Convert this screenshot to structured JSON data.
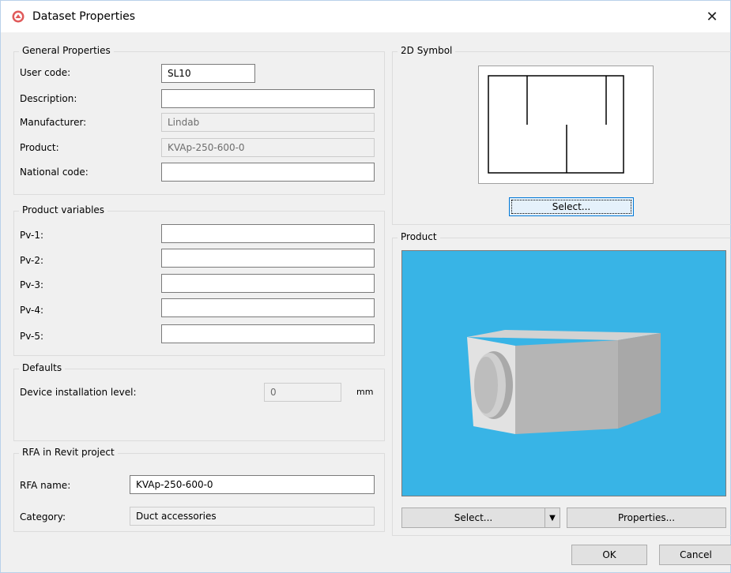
{
  "window": {
    "title": "Dataset Properties",
    "close_glyph": "✕"
  },
  "general": {
    "heading": "General Properties",
    "user_code_label": "User code:",
    "user_code_value": "SL10",
    "description_label": "Description:",
    "description_value": "",
    "manufacturer_label": "Manufacturer:",
    "manufacturer_value": "Lindab",
    "product_label": "Product:",
    "product_value": "KVAp-250-600-0",
    "national_code_label": "National code:",
    "national_code_value": ""
  },
  "product_variables": {
    "heading": "Product variables",
    "items": [
      {
        "label": "Pv-1:",
        "value": ""
      },
      {
        "label": "Pv-2:",
        "value": ""
      },
      {
        "label": "Pv-3:",
        "value": ""
      },
      {
        "label": "Pv-4:",
        "value": ""
      },
      {
        "label": "Pv-5:",
        "value": ""
      }
    ]
  },
  "defaults": {
    "heading": "Defaults",
    "device_level_label": "Device installation level:",
    "device_level_value": "0",
    "unit": "mm"
  },
  "rfa": {
    "heading": "RFA in Revit project",
    "name_label": "RFA name:",
    "name_value": "KVAp-250-600-0",
    "category_label": "Category:",
    "category_value": "Duct accessories"
  },
  "symbol": {
    "heading": "2D Symbol",
    "select_label": "Select..."
  },
  "product": {
    "heading": "Product",
    "select_label": "Select...",
    "dropdown_glyph": "▼",
    "properties_label": "Properties...",
    "viewport_color": "#38b4e6"
  },
  "footer": {
    "ok_label": "OK",
    "cancel_label": "Cancel"
  },
  "icons": {
    "app": "app-logo-icon",
    "close": "close-icon",
    "dropdown": "chevron-down-icon"
  }
}
